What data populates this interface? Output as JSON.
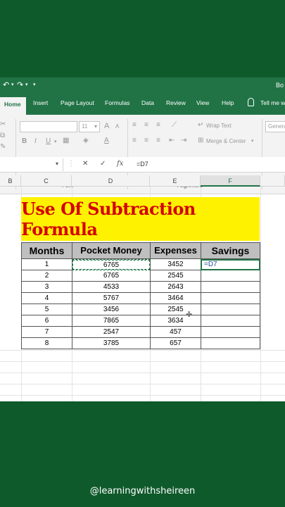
{
  "titlebar": {
    "quick_access": [
      "↶",
      "▾",
      "↷",
      "▾",
      "▾"
    ],
    "book": "Bo"
  },
  "tabs": [
    "Home",
    "Insert",
    "Page Layout",
    "Formulas",
    "Data",
    "Review",
    "View",
    "Help"
  ],
  "tell_me": "Tell me w",
  "ribbon": {
    "font_name": "",
    "font_size": "11",
    "font_size_arrow": "▾",
    "grow_font": "A",
    "shrink_font": "A",
    "bold": "B",
    "italic": "I",
    "underline": "U",
    "wrap_text": "Wrap Text",
    "merge_center": "Merge & Center",
    "number_format": "Genera",
    "font_group": "Font",
    "alignment_group": "Alignment"
  },
  "formula_bar": {
    "namebox_arrow": "▾",
    "cancel": "✕",
    "enter": "✓",
    "fx": "fx",
    "content": "=D7"
  },
  "columns": [
    "B",
    "C",
    "D",
    "E",
    "F"
  ],
  "banner": "Use Of Subtraction Formula",
  "table": {
    "headers": [
      "Months",
      "Pocket Money",
      "Expenses",
      "Savings"
    ],
    "rows": [
      [
        "1",
        "6765",
        "3452",
        "=D7"
      ],
      [
        "2",
        "6765",
        "2545",
        ""
      ],
      [
        "3",
        "4533",
        "2643",
        ""
      ],
      [
        "4",
        "5767",
        "3464",
        ""
      ],
      [
        "5",
        "3456",
        "2545",
        ""
      ],
      [
        "6",
        "7865",
        "3634",
        ""
      ],
      [
        "7",
        "2547",
        "457",
        ""
      ],
      [
        "8",
        "3785",
        "657",
        ""
      ]
    ]
  },
  "watermark": "@learningwithsheireen",
  "colors": {
    "excel_green": "#217346",
    "background_green": "#0f5a2b",
    "banner_yellow": "#fff200",
    "banner_red": "#d40000"
  }
}
